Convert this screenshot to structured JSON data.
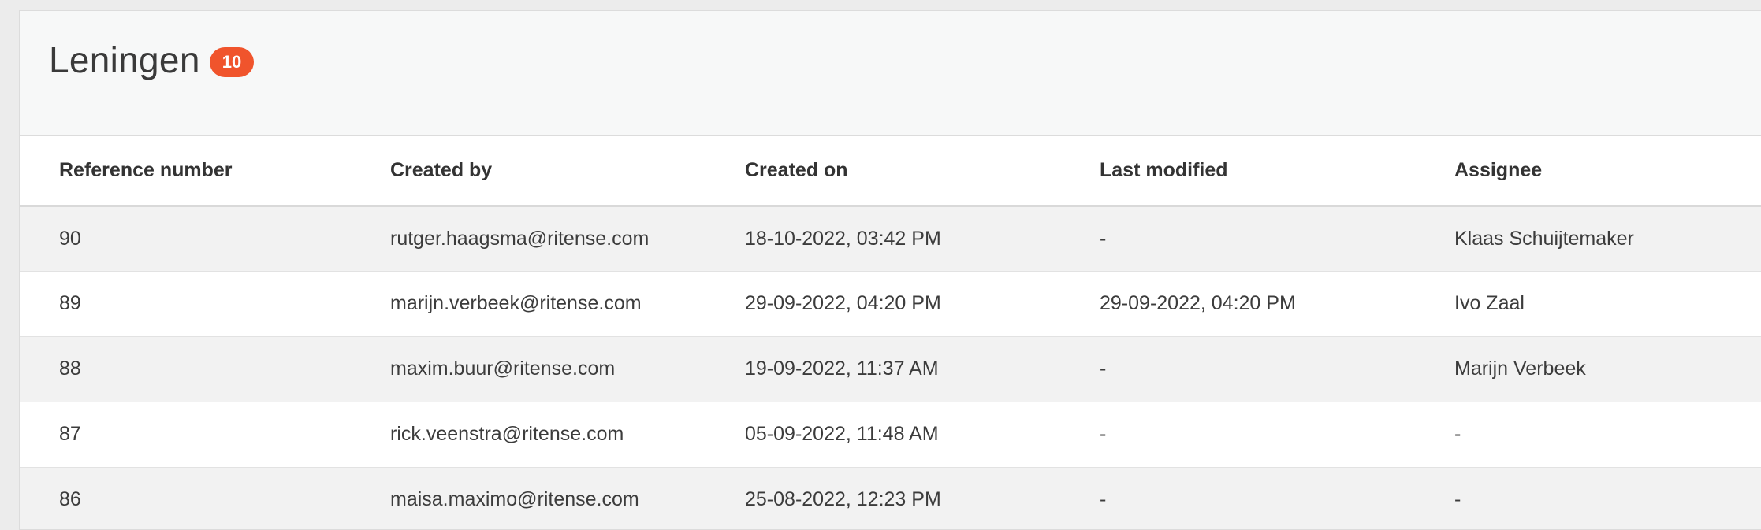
{
  "header": {
    "title": "Leningen",
    "count": "10"
  },
  "table": {
    "columns": [
      "Reference number",
      "Created by",
      "Created on",
      "Last modified",
      "Assignee"
    ],
    "rows": [
      [
        "90",
        "rutger.haagsma@ritense.com",
        "18-10-2022, 03:42 PM",
        "-",
        "Klaas Schuijtemaker"
      ],
      [
        "89",
        "marijn.verbeek@ritense.com",
        "29-09-2022, 04:20 PM",
        "29-09-2022, 04:20 PM",
        "Ivo Zaal"
      ],
      [
        "88",
        "maxim.buur@ritense.com",
        "19-09-2022, 11:37 AM",
        "-",
        "Marijn Verbeek"
      ],
      [
        "87",
        "rick.veenstra@ritense.com",
        "05-09-2022, 11:48 AM",
        "-",
        "-"
      ],
      [
        "86",
        "maisa.maximo@ritense.com",
        "25-08-2022, 12:23 PM",
        "-",
        "-"
      ]
    ]
  }
}
